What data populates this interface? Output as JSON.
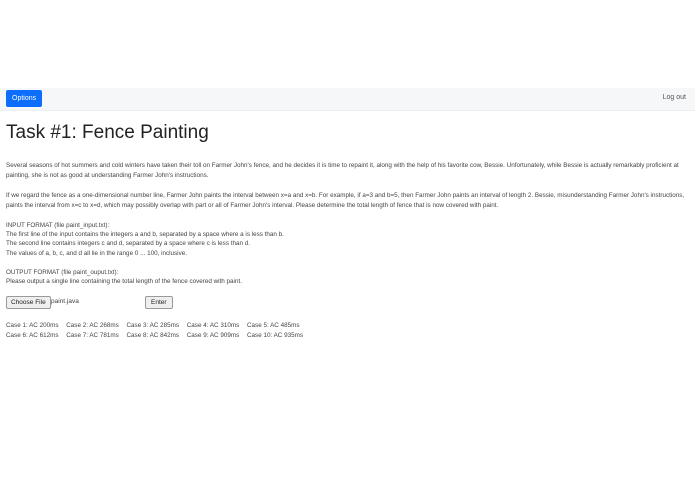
{
  "navbar": {
    "options_label": "Options",
    "logout_label": "Log out"
  },
  "page": {
    "title": "Task #1: Fence Painting",
    "paragraph1": "Several seasons of hot summers and cold winters have taken their toll on Farmer John's fence, and he decides it is time to repaint it, along with the help of his favorite cow, Bessie. Unfortunately, while Bessie is actually remarkably proficient at painting, she is not as good at understanding Farmer John's instructions.",
    "paragraph2": "If we regard the fence as a one-dimensional number line, Farmer John paints the interval between x=a and x=b. For example, if a=3 and b=5, then Farmer John paints an interval of length 2. Bessie, misunderstanding Farmer John's instructions, paints the interval from x=c to x=d, which may possibly overlap with part or all of Farmer John's interval. Please determine the total length of fence that is now covered with paint.",
    "input_format": [
      "INPUT FORMAT (file paint_input.txt):",
      "The first line of the input contains the integers a and b, separated by a space where a is less than b.",
      "The second line contains integers c and d, separated by a space where c is less than d.",
      "The values of a, b, c, and d all lie in the range 0 ... 100, inclusive."
    ],
    "output_format": [
      "OUTPUT FORMAT (file paint_ouput.txt):",
      "Please output a single line containing the total length of the fence covered with paint."
    ]
  },
  "upload": {
    "choose_file_label": "Choose File",
    "file_name": "paint.java",
    "enter_label": "Enter"
  },
  "results": [
    [
      "Case 1: AC 200ms",
      "Case 2: AC 268ms",
      "Case 3: AC 285ms",
      "Case 4: AC 310ms",
      "Case 5: AC 485ms"
    ],
    [
      "Case 6: AC 612ms",
      "Case 7: AC 781ms",
      "Case 8: AC 842ms",
      "Case 9: AC 909ms",
      "Case 10: AC 935ms"
    ]
  ]
}
